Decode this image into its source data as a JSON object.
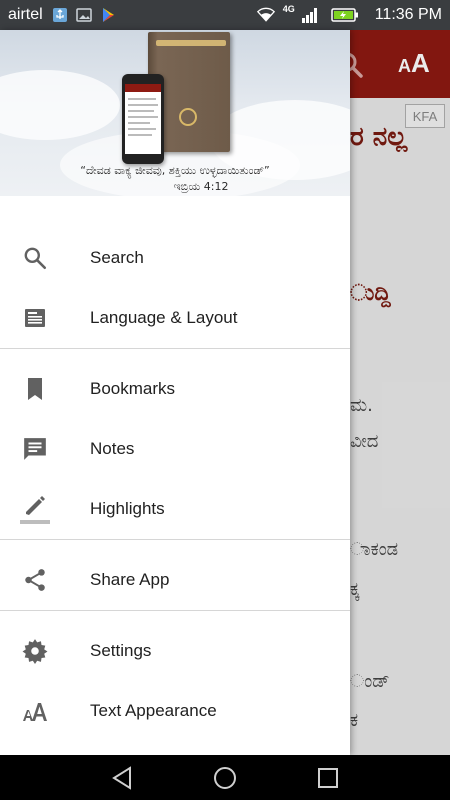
{
  "status_bar": {
    "carrier": "airtel",
    "network": "4G",
    "time": "11:36 PM"
  },
  "background_app": {
    "toolbar_aa_label": "A",
    "toolbar_aa_small": "A",
    "kfa_label": "KFA",
    "visible_lines": [
      {
        "text": "ರ ನಲ್ಲ",
        "heading": true
      },
      {
        "text": "ುದ್ದಿ",
        "heading": true
      },
      {
        "text": "ಮ.",
        "heading": false
      },
      {
        "text": "ವೀದ",
        "heading": false
      },
      {
        "text": "ಾಕಂಡ",
        "heading": false
      },
      {
        "text": "ಕ್ಕ",
        "heading": false
      },
      {
        "text": "ಂಡ್",
        "heading": false
      },
      {
        "text": "ಕ",
        "heading": false
      }
    ]
  },
  "drawer": {
    "header": {
      "quote": "“ದೇವಡ ವಾಕ್ಯ ಜೀವವು, ಶಕ್ತಿಯು ಉಳ್ಳದಾಯಿತುಂಡ್”",
      "reference": "ಇಬ್ರಿಯ 4:12"
    },
    "sections": [
      {
        "items": [
          {
            "label": "Search",
            "icon": "search-icon"
          },
          {
            "label": "Language & Layout",
            "icon": "layout-icon"
          }
        ]
      },
      {
        "items": [
          {
            "label": "Bookmarks",
            "icon": "bookmark-icon"
          },
          {
            "label": "Notes",
            "icon": "note-icon"
          },
          {
            "label": "Highlights",
            "icon": "highlighter-icon"
          }
        ]
      },
      {
        "items": [
          {
            "label": "Share App",
            "icon": "share-icon"
          }
        ]
      },
      {
        "items": [
          {
            "label": "Settings",
            "icon": "gear-icon"
          },
          {
            "label": "Text Appearance",
            "icon": "text-size-icon"
          }
        ]
      }
    ]
  },
  "colors": {
    "toolbar": "#8e1a12",
    "icon_gray": "#616161",
    "divider": "#d6d6d6"
  }
}
